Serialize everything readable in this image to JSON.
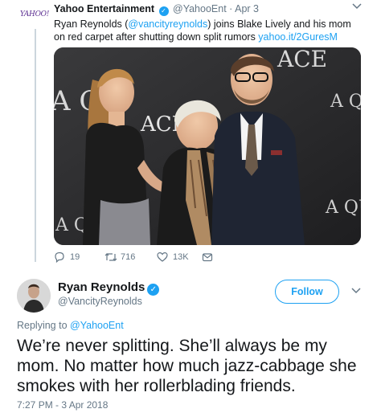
{
  "quoted_tweet": {
    "avatar_text": "YAHOO!",
    "name": "Yahoo Entertainment",
    "verified_glyph": "✓",
    "handle": "@YahooEnt",
    "separator": "·",
    "time": "Apr 3",
    "text_before_mention": "Ryan Reynolds (",
    "mention": "@vancityreynolds",
    "text_after_mention": ") joins Blake Lively and his mom on red carpet after shutting down split rumors ",
    "link": "yahoo.it/2GuresM",
    "photo": {
      "backdrop_left": "A QU",
      "backdrop_top_right": "ACE",
      "backdrop_center": "ACE",
      "backdrop_right": "A Q",
      "backdrop_mid_right": "A QU",
      "backdrop_bottom_left": "A Q"
    },
    "actions": {
      "replies": "19",
      "retweets": "716",
      "likes": "13K"
    }
  },
  "main_tweet": {
    "name": "Ryan Reynolds",
    "verified_glyph": "✓",
    "handle": "@VancityReynolds",
    "follow_label": "Follow",
    "replying_prefix": "Replying to ",
    "replying_to": "@YahooEnt",
    "text": "We’re never splitting. She’ll always be my mom. No matter how much jazz-cabbage she smokes with her rollerblading friends.",
    "timestamp": "7:27 PM - 3 Apr 2018"
  },
  "colors": {
    "link": "#1da1f2",
    "muted": "#657786",
    "text": "#14171a",
    "divider": "#ccd6dd",
    "yahoo_purple": "#5b2e91"
  },
  "icons": [
    "reply-icon",
    "retweet-icon",
    "like-icon",
    "dm-icon",
    "chevron-down-icon",
    "verified-icon"
  ]
}
